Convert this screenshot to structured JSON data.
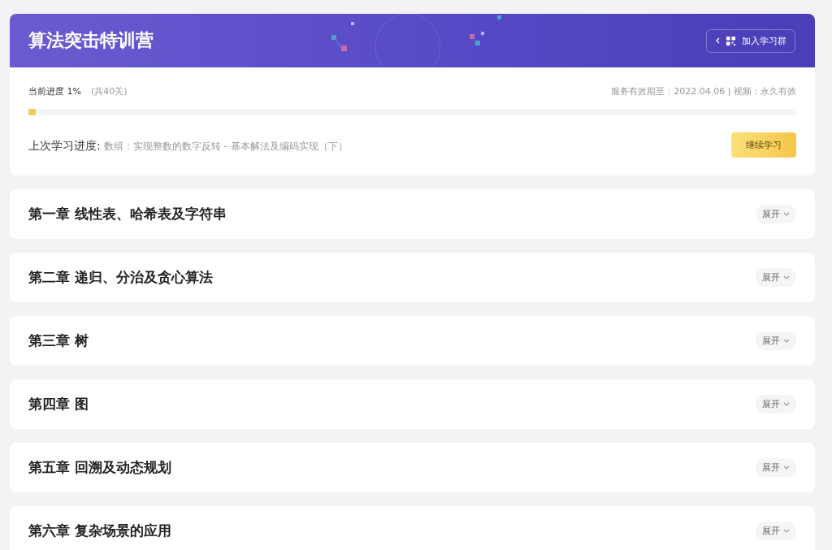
{
  "course": {
    "title": "算法突击特训营",
    "join_group_button": "加入学习群"
  },
  "progress": {
    "label": "当前进度 1%",
    "total": "(共40关)",
    "validity": "服务有效期至：2022.04.06 | 视频：永久有效",
    "level": 0.01,
    "last_label": "上次学习进度:",
    "last_lesson": "数组：实现整数的数字反转 - 基本解法及编码实现（下）",
    "continue_button": "继续学习"
  },
  "chapters": [
    {
      "title": "第一章 线性表、哈希表及字符串",
      "toggle": "展开"
    },
    {
      "title": "第二章 递归、分治及贪心算法",
      "toggle": "展开"
    },
    {
      "title": "第三章 树",
      "toggle": "展开"
    },
    {
      "title": "第四章 图",
      "toggle": "展开"
    },
    {
      "title": "第五章 回溯及动态规划",
      "toggle": "展开"
    },
    {
      "title": "第六章 复杂场景的应用",
      "toggle": "展开"
    }
  ]
}
